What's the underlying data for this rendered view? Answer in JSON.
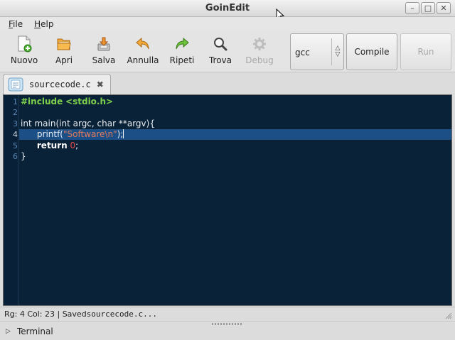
{
  "window": {
    "title": "GoinEdit"
  },
  "menu": {
    "file": "File",
    "help": "Help"
  },
  "toolbar": {
    "new": "Nuovo",
    "open": "Apri",
    "save": "Salva",
    "undo": "Annulla",
    "redo": "Ripeti",
    "find": "Trova",
    "debug": "Debug",
    "compiler": "gcc",
    "compile": "Compile",
    "run": "Run"
  },
  "tab": {
    "label": "sourcecode.c"
  },
  "editor": {
    "line_numbers": [
      "1",
      "2",
      "3",
      "4",
      "5",
      "6"
    ],
    "current_line": 4,
    "line1": {
      "kw": "#include",
      "hdr": "<stdio.h>"
    },
    "line3": {
      "t1": "int",
      "t2": " main(",
      "t3": "int",
      "t4": " argc, ",
      "t5": "char",
      "t6": " **argv){"
    },
    "line4": {
      "indent": "      ",
      "fn": "printf(",
      "str": "\"Software\\n\"",
      "end": ");"
    },
    "line5": {
      "indent": "      ",
      "kw": "return",
      "sp": " ",
      "num": "0",
      "end": ";"
    },
    "line6": {
      "text": "}"
    }
  },
  "status": {
    "position": "Rg: 4 Col: 23 | Saved ",
    "file": "sourcecode.c..."
  },
  "terminal": {
    "label": "Terminal"
  },
  "colors": {
    "editor_bg": "#0a2238",
    "current_line": "#1b4f86",
    "include": "#7ed04a",
    "string": "#e07a5e",
    "number": "#e24b4b"
  }
}
